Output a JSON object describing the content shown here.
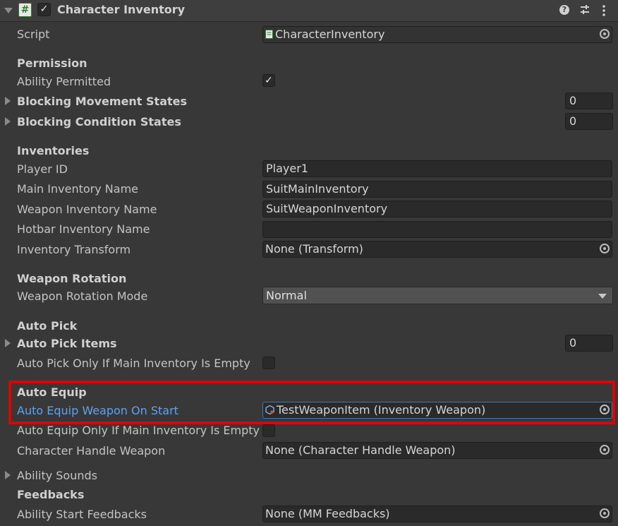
{
  "header": {
    "title": "Character Inventory",
    "enabled": true
  },
  "script": {
    "label": "Script",
    "value": "CharacterInventory"
  },
  "permission": {
    "heading": "Permission",
    "ability_permitted_label": "Ability Permitted",
    "ability_permitted": true,
    "blocking_movement_label": "Blocking Movement States",
    "blocking_movement_count": "0",
    "blocking_condition_label": "Blocking Condition States",
    "blocking_condition_count": "0"
  },
  "inventories": {
    "heading": "Inventories",
    "player_id_label": "Player ID",
    "player_id": "Player1",
    "main_label": "Main Inventory Name",
    "main_value": "SuitMainInventory",
    "weapon_label": "Weapon Inventory Name",
    "weapon_value": "SuitWeaponInventory",
    "hotbar_label": "Hotbar Inventory Name",
    "hotbar_value": "",
    "transform_label": "Inventory Transform",
    "transform_value": "None (Transform)"
  },
  "weapon_rotation": {
    "heading": "Weapon Rotation",
    "mode_label": "Weapon Rotation Mode",
    "mode_value": "Normal"
  },
  "auto_pick": {
    "heading": "Auto Pick",
    "items_label": "Auto Pick Items",
    "items_count": "0",
    "only_if_empty_label": "Auto Pick Only If Main Inventory Is Empty",
    "only_if_empty": false
  },
  "auto_equip": {
    "heading": "Auto Equip",
    "weapon_on_start_label": "Auto Equip Weapon On Start",
    "weapon_on_start_value": "TestWeaponItem (Inventory Weapon)",
    "only_if_empty_label": "Auto Equip Only If Main Inventory Is Empty",
    "only_if_empty": false,
    "handle_weapon_label": "Character Handle Weapon",
    "handle_weapon_value": "None (Character Handle Weapon)"
  },
  "sounds": {
    "label": "Ability Sounds"
  },
  "feedbacks": {
    "heading": "Feedbacks",
    "start_label": "Ability Start Feedbacks",
    "start_value": "None (MM Feedbacks)"
  },
  "colors": {
    "background": "#383838",
    "field": "#2a2a2a",
    "link_label": "#5fa2f2",
    "highlight": "#e10000"
  }
}
